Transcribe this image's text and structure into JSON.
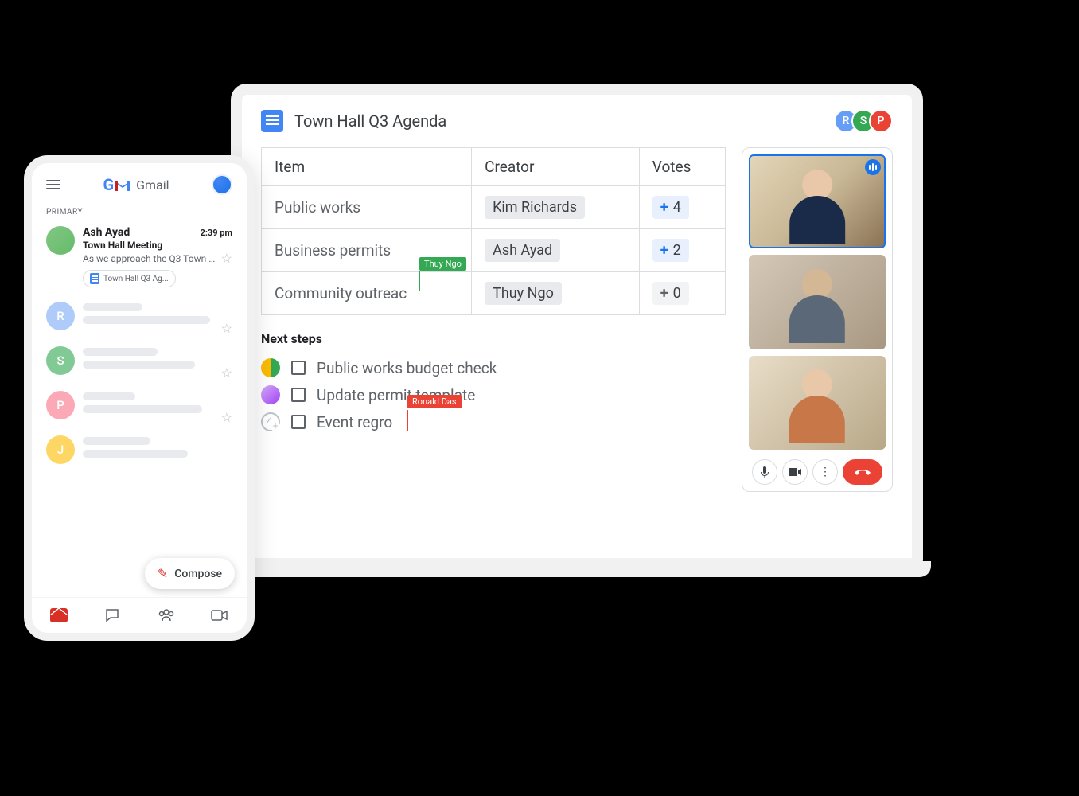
{
  "gmail": {
    "app_name": "Gmail",
    "category": "PRIMARY",
    "email": {
      "sender": "Ash Ayad",
      "time": "2:39 pm",
      "subject": "Town Hall Meeting",
      "preview": "As we approach the Q3 Town Ha...",
      "attachment": "Town Hall Q3 Ag..."
    },
    "placeholder_avatars": [
      {
        "letter": "R",
        "color": "#aecbfa"
      },
      {
        "letter": "S",
        "color": "#81c995"
      },
      {
        "letter": "P",
        "color": "#fba9b6"
      },
      {
        "letter": "J",
        "color": "#fdd663"
      }
    ],
    "compose": "Compose"
  },
  "doc": {
    "title": "Town Hall Q3 Agenda",
    "collaborators": [
      {
        "letter": "R",
        "color": "#669df6"
      },
      {
        "letter": "S",
        "color": "#34a853"
      },
      {
        "letter": "P",
        "color": "#ea4335"
      }
    ],
    "table": {
      "headers": {
        "item": "Item",
        "creator": "Creator",
        "votes": "Votes"
      },
      "rows": [
        {
          "item": "Public works",
          "creator": "Kim Richards",
          "votes": "4"
        },
        {
          "item": "Business permits",
          "creator": "Ash Ayad",
          "votes": "2"
        },
        {
          "item": "Community outreac",
          "creator": "Thuy Ngo",
          "votes": "0"
        }
      ]
    },
    "cursors": {
      "green": "Thuy Ngo",
      "red": "Ronald Das"
    },
    "next_steps": {
      "title": "Next steps",
      "items": [
        "Public works budget check",
        "Update permit template",
        "Event regro"
      ]
    }
  }
}
